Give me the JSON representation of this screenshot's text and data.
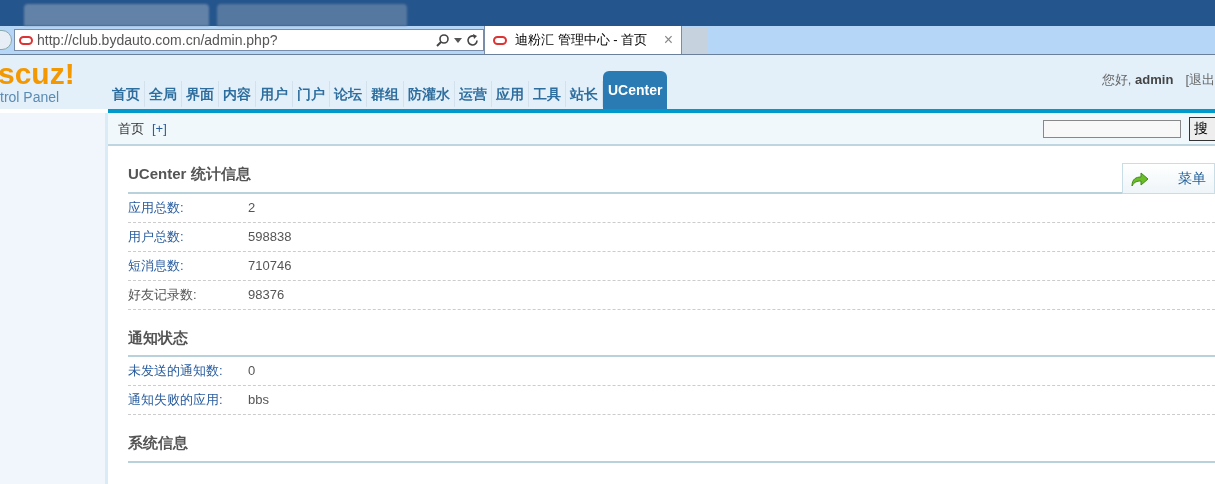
{
  "browser": {
    "address": "http://club.bydauto.com.cn/admin.php?",
    "tab": {
      "title": "迪粉汇 管理中心 - 首页",
      "close": "×"
    }
  },
  "logo": {
    "brand": "scuz!",
    "subtitle": "trol Panel"
  },
  "nav": [
    {
      "label": "首页",
      "selected": false
    },
    {
      "label": "全局",
      "selected": false
    },
    {
      "label": "界面",
      "selected": false
    },
    {
      "label": "内容",
      "selected": false
    },
    {
      "label": "用户",
      "selected": false
    },
    {
      "label": "门户",
      "selected": false
    },
    {
      "label": "论坛",
      "selected": false
    },
    {
      "label": "群组",
      "selected": false
    },
    {
      "label": "防灌水",
      "selected": false
    },
    {
      "label": "运营",
      "selected": false
    },
    {
      "label": "应用",
      "selected": false
    },
    {
      "label": "工具",
      "selected": false
    },
    {
      "label": "站长",
      "selected": false
    },
    {
      "label": "UCenter",
      "selected": true
    }
  ],
  "user": {
    "greeting": "您好,",
    "name": "admin",
    "logout": "[退出"
  },
  "breadcrumb": {
    "home": "首页",
    "add": "[+]"
  },
  "search": {
    "button": "搜"
  },
  "menu_button": "菜单",
  "sections": [
    {
      "title": "UCenter 统计信息",
      "rows": [
        {
          "label": "应用总数:",
          "value": "2",
          "link": true
        },
        {
          "label": "用户总数:",
          "value": "598838",
          "link": true
        },
        {
          "label": "短消息数:",
          "value": "710746",
          "link": true
        },
        {
          "label": "好友记录数:",
          "value": "98376",
          "link": false
        }
      ]
    },
    {
      "title": "通知状态",
      "rows": [
        {
          "label": "未发送的通知数:",
          "value": "0",
          "link": true
        },
        {
          "label": "通知失败的应用:",
          "value": "bbs",
          "link": true
        }
      ]
    },
    {
      "title": "系统信息"
    }
  ]
}
